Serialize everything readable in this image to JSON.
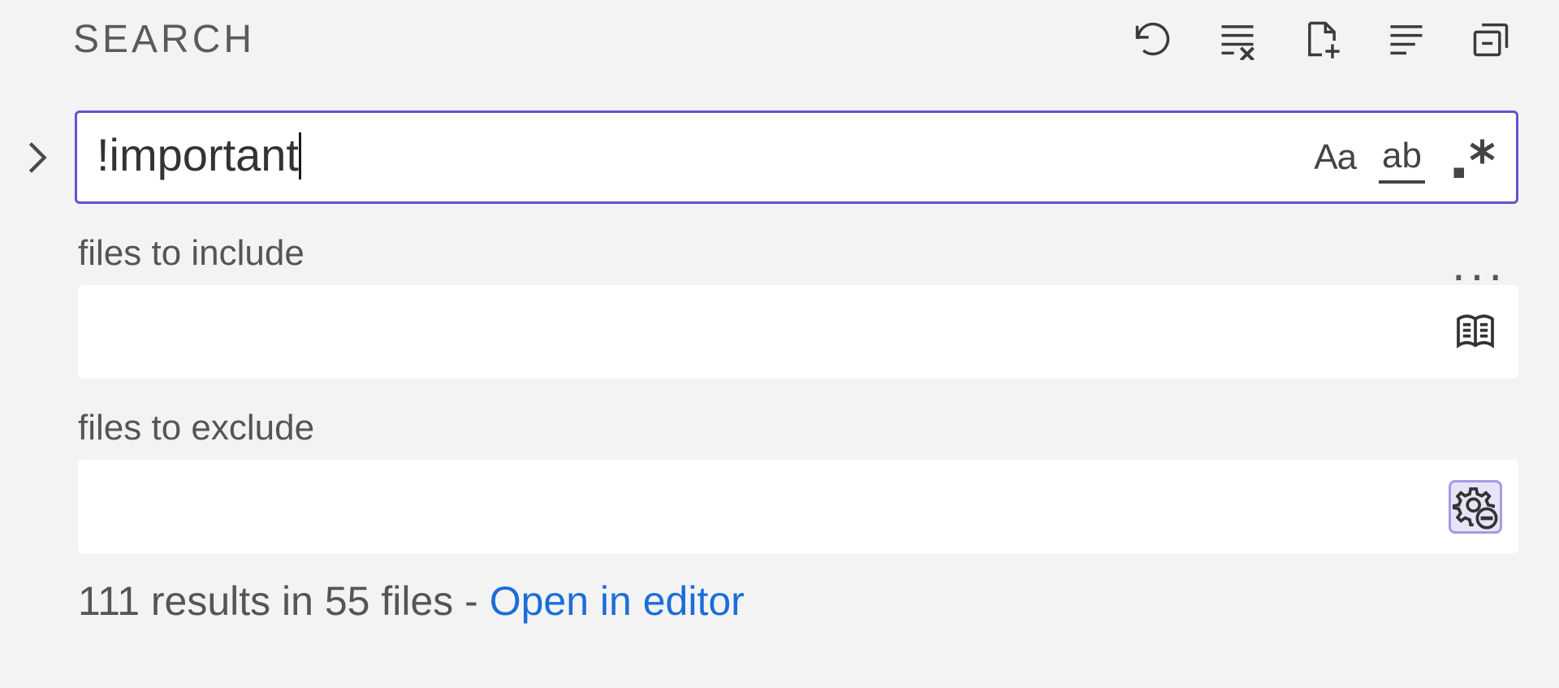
{
  "header": {
    "title": "SEARCH",
    "actions": {
      "refresh": "refresh",
      "clear": "clear-results",
      "new_editor": "new-search-editor",
      "view_tree": "view-as-tree",
      "collapse": "collapse-all"
    }
  },
  "search": {
    "query": "!important",
    "options": {
      "case_label": "Aa",
      "word_label": "ab",
      "regex_label": ".*"
    }
  },
  "include": {
    "label": "files to include",
    "value": ""
  },
  "exclude": {
    "label": "files to exclude",
    "value": ""
  },
  "results": {
    "text": "111 results in 55 files - ",
    "link_label": "Open in editor",
    "count": 111,
    "files": 55
  },
  "more_label": "..."
}
